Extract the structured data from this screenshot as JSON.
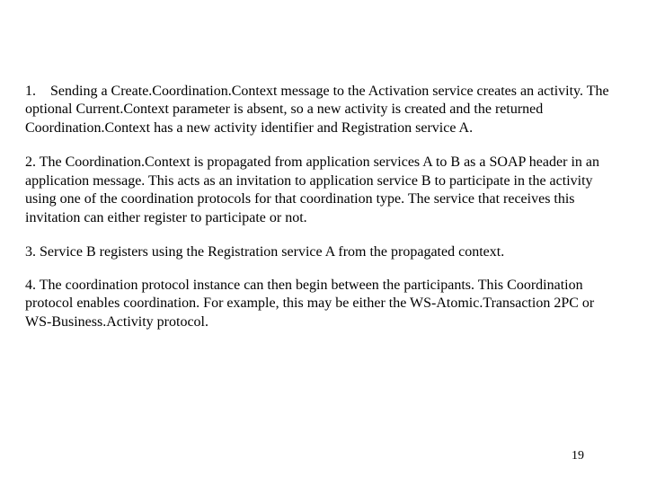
{
  "paragraphs": {
    "p1": "1. Sending a Create.Coordination.Context message to the Activation service creates an activity. The optional Current.Context parameter is absent, so a new activity is created and the returned  Coordination.Context has a new activity identifier and Registration service A.",
    "p2": "2. The Coordination.Context is propagated from application services A to B as a SOAP header in an application message. This acts as an invitation to application service B to participate in the activity using one of the coordination protocols for that coordination type.  The service that receives this invitation can either register to participate or not.",
    "p3": "3. Service B registers using the Registration service A from the propagated context.",
    "p4": "4. The coordination protocol instance can then begin between the participants. This Coordination protocol enables coordination. For example, this may be either the WS-Atomic.Transaction 2PC or WS-Business.Activity protocol."
  },
  "page_number": "19"
}
